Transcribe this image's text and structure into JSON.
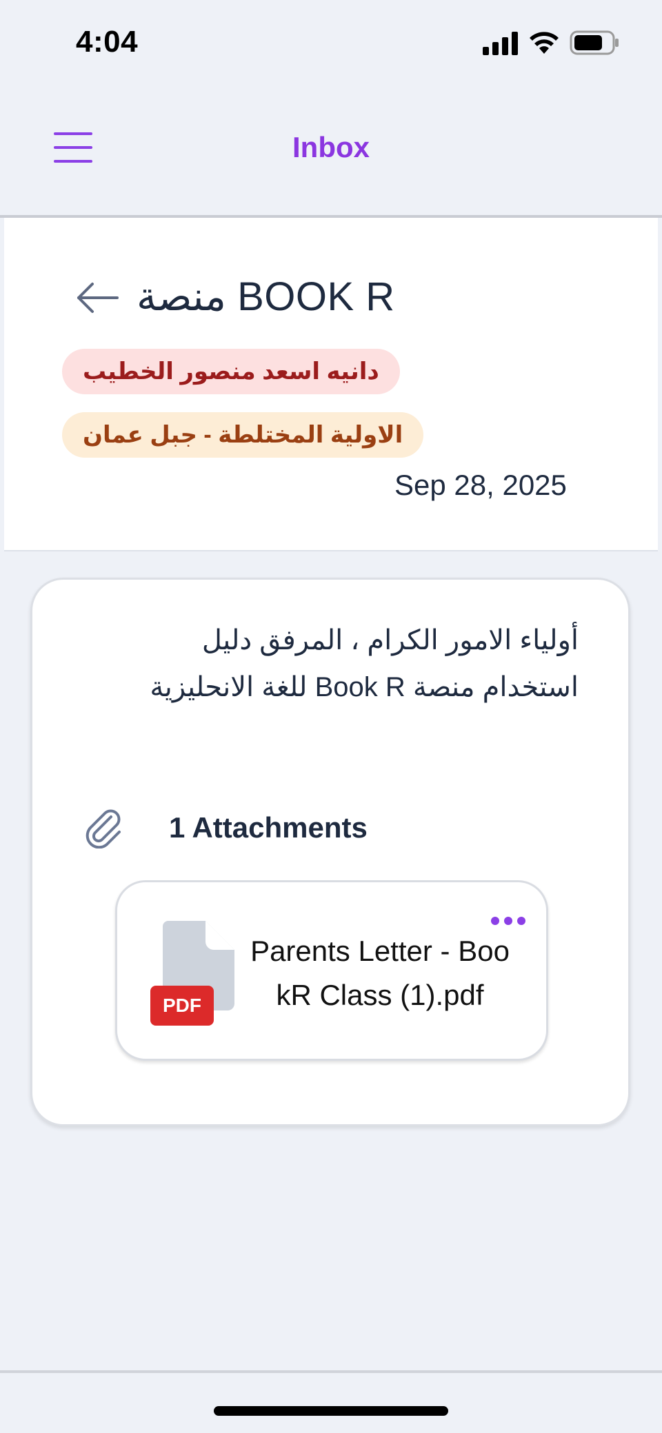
{
  "status_bar": {
    "time": "4:04",
    "icons": [
      "signal-icon",
      "wifi-icon",
      "battery-icon"
    ]
  },
  "header": {
    "title": "Inbox",
    "menu_icon": "hamburger-menu-icon",
    "accent_color": "#8b36e0"
  },
  "message": {
    "back_icon": "back-arrow-icon",
    "subject": "منصة BOOK R",
    "sender_tag": "دانيه اسعد منصور الخطيب",
    "school_tag": "الاولية المختلطة - جبل عمان",
    "date": "Sep 28, 2025",
    "body_line_1": "أولياء الامور الكرام ، المرفق دليل",
    "body_line_2": "استخدام منصة Book R للغة الانحليزية"
  },
  "attachments": {
    "icon": "paperclip-icon",
    "count_label": "1 Attachments",
    "files": [
      {
        "name": "Parents Letter - BookR Class (1).pdf",
        "type_badge": "PDF",
        "icon": "pdf-file-icon"
      }
    ]
  },
  "colors": {
    "background": "#eef1f7",
    "sender_tag_bg": "#fde0e0",
    "sender_tag_text": "#9b1c1c",
    "school_tag_bg": "#fdedd6",
    "school_tag_text": "#9a3f12",
    "pdf_badge": "#dc2a2a"
  }
}
